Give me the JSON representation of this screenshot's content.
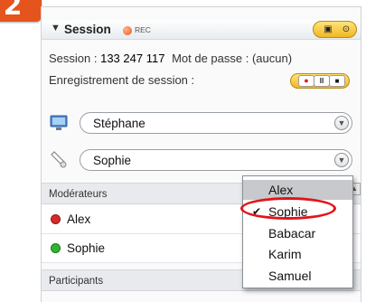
{
  "step_badge": "2",
  "pod": {
    "title": "Session",
    "rec_label": "REC",
    "header_buttons": {
      "camera_icon": "▣",
      "circle_icon": "⊙"
    }
  },
  "session": {
    "id_label": "Session : ",
    "id_value": "133 247 117",
    "password_label": "Mot de passe : (aucun)",
    "recording_label": "Enregistrement de session :",
    "rec_buttons": {
      "record": "●",
      "pause": "ll",
      "stop": "■"
    }
  },
  "selectors": [
    {
      "value": "Stéphane",
      "icon": "monitor-icon"
    },
    {
      "value": "Sophie",
      "icon": "pointer-icon"
    }
  ],
  "moderators": {
    "header": "Modérateurs",
    "rows": [
      {
        "name": "Alex",
        "status_color": "#d82a2a"
      },
      {
        "name": "Sophie",
        "status_color": "#2fb52f"
      }
    ]
  },
  "participants": {
    "header": "Participants"
  },
  "dropdown": {
    "items": [
      {
        "label": "Alex",
        "hovered": true,
        "checked": false
      },
      {
        "label": "Sophie",
        "hovered": false,
        "checked": true
      },
      {
        "label": "Babacar",
        "hovered": false,
        "checked": false
      },
      {
        "label": "Karim",
        "hovered": false,
        "checked": false
      },
      {
        "label": "Samuel",
        "hovered": false,
        "checked": false
      }
    ],
    "check_glyph": "✔"
  },
  "colors": {
    "accent": "#e4541c",
    "highlight": "#e0151c",
    "controls": "#f0b824"
  }
}
